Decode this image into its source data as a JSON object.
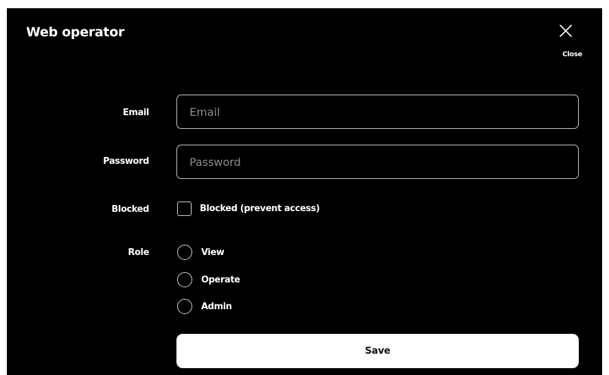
{
  "dialog": {
    "title": "Web operator",
    "close_label": "Close",
    "close_icon": "close-icon"
  },
  "form": {
    "email": {
      "label": "Email",
      "placeholder": "Email",
      "value": ""
    },
    "password": {
      "label": "Password",
      "placeholder": "Password",
      "value": ""
    },
    "blocked": {
      "label": "Blocked",
      "option_label": "Blocked (prevent access)",
      "checked": false
    },
    "role": {
      "label": "Role",
      "options": [
        {
          "label": "View",
          "selected": false
        },
        {
          "label": "Operate",
          "selected": false
        },
        {
          "label": "Admin",
          "selected": false
        }
      ]
    },
    "save_label": "Save"
  },
  "colors": {
    "dialog_background": "#000000",
    "page_background": "#ffffff",
    "text": "#ffffff",
    "border": "#cfcfcf",
    "placeholder": "#8e8e8e",
    "save_button_background": "#ffffff",
    "save_button_text": "#111111"
  }
}
